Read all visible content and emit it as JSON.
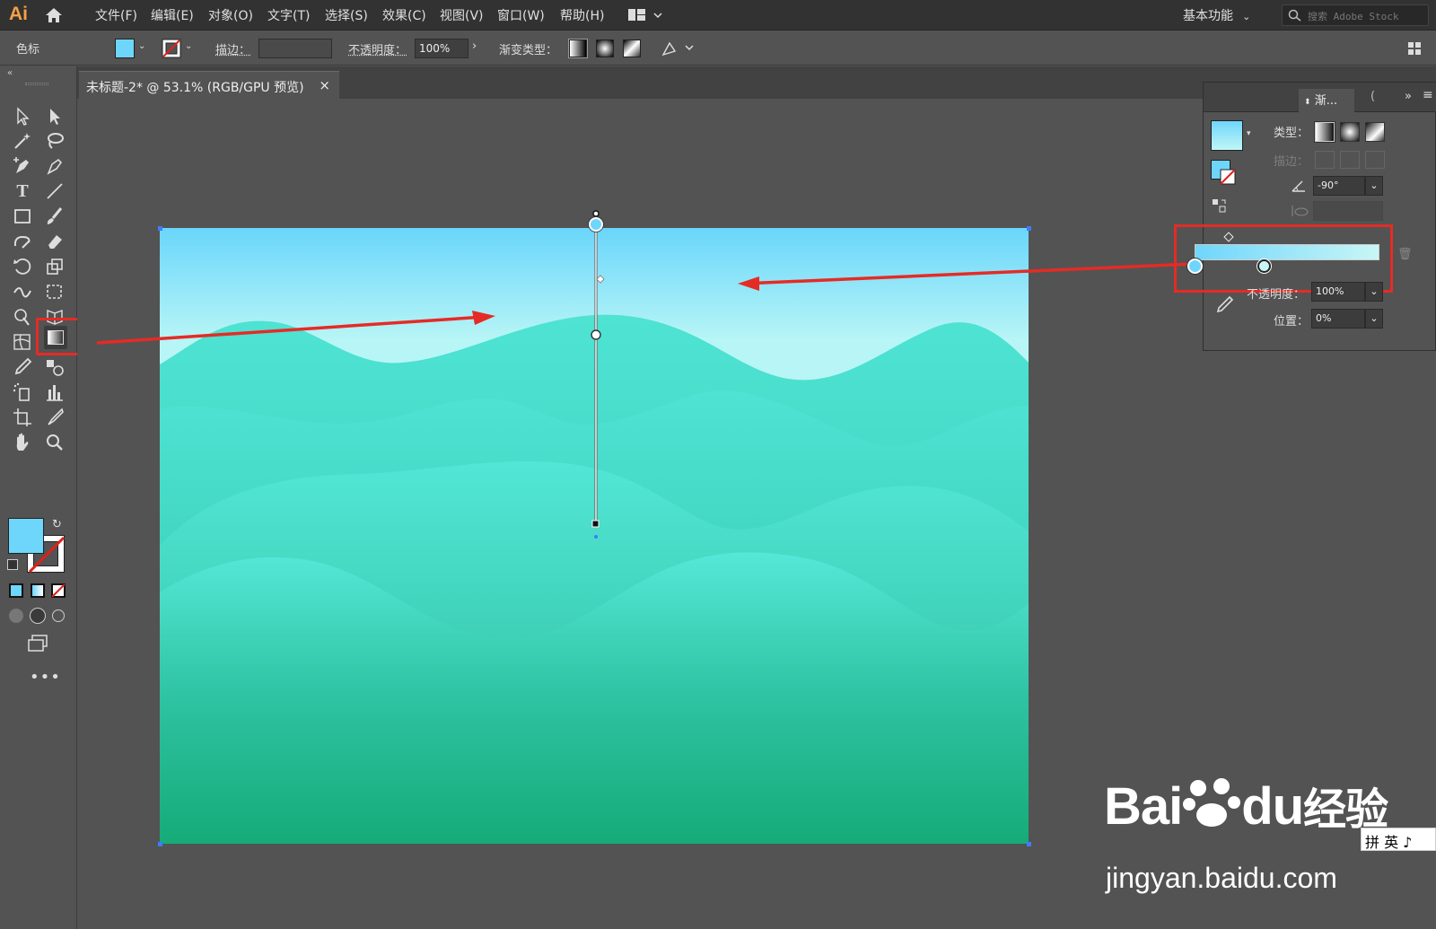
{
  "app": {
    "logo": "Ai"
  },
  "menu": [
    "文件(F)",
    "编辑(E)",
    "对象(O)",
    "文字(T)",
    "选择(S)",
    "效果(C)",
    "视图(V)",
    "窗口(W)",
    "帮助(H)"
  ],
  "workspace": "基本功能",
  "search": {
    "placeholder": "搜索 Adobe Stock"
  },
  "control": {
    "object_label": "色标",
    "stroke_label": "描边：",
    "opacity_label": "不透明度：",
    "opacity_value": "100%",
    "gradient_type_label": "渐变类型："
  },
  "document_tab": {
    "title": "未标题-2* @ 53.1% (RGB/GPU 预览)",
    "close": "×"
  },
  "gradient_panel": {
    "tab_label": "渐...",
    "type_label": "类型：",
    "stroke_label": "描边：",
    "angle_value": "-90°",
    "opacity_label": "不透明度：",
    "opacity_value": "100%",
    "position_label": "位置：",
    "position_value": "0%"
  },
  "colors": {
    "fill": "#6fd6fb",
    "sky_top": "#6ad6fb",
    "sky_bottom": "#b7f5f6",
    "sea_light": "#4ee3d3",
    "sea_dark": "#16ab78",
    "annotation": "#e52b25"
  },
  "watermark": {
    "logo_a": "Bai",
    "logo_b": "du",
    "logo_c": "经验",
    "url": "jingyan.baidu.com",
    "ime": "拼 英 ♪"
  }
}
